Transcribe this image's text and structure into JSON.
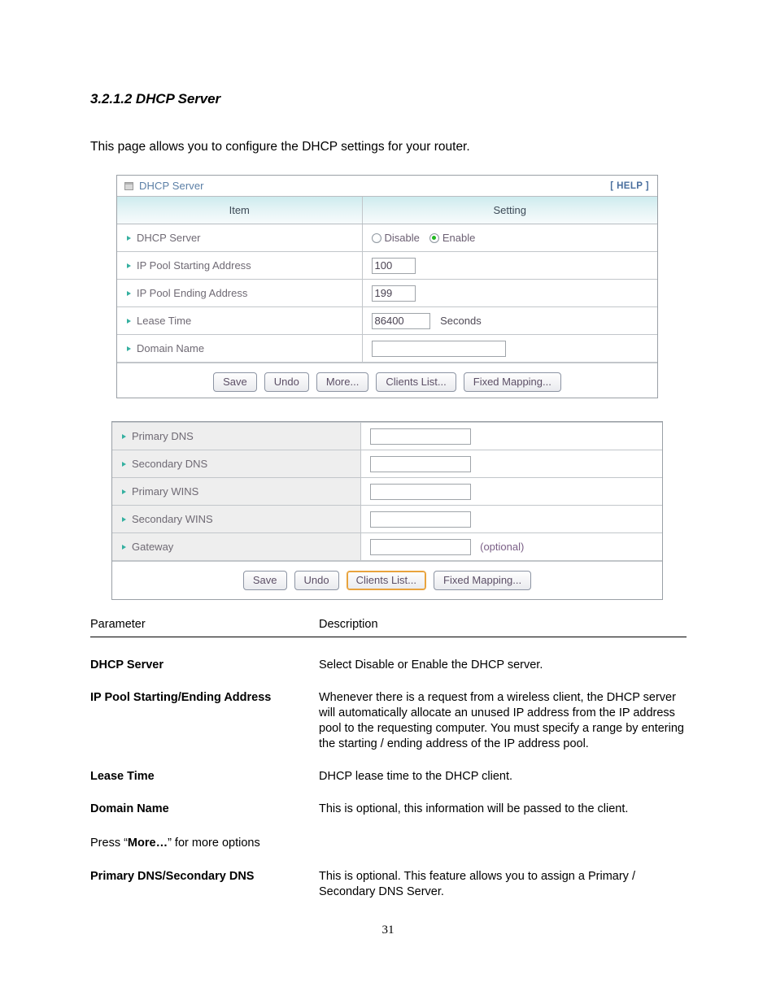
{
  "document": {
    "heading": "3.2.1.2 DHCP Server",
    "intro": "This page allows you to configure the DHCP settings for your router.",
    "page_number": "31"
  },
  "router_ui": {
    "panel_main": {
      "title": "DHCP Server",
      "title_icon": "window-icon",
      "help_label": "[ HELP ]",
      "columns": {
        "item": "Item",
        "setting": "Setting"
      },
      "rows": [
        {
          "label": "DHCP Server",
          "type": "radio",
          "options": [
            {
              "label": "Disable",
              "checked": false
            },
            {
              "label": "Enable",
              "checked": true
            }
          ]
        },
        {
          "label": "IP Pool Starting Address",
          "type": "text",
          "value": "100",
          "placeholder": ""
        },
        {
          "label": "IP Pool Ending Address",
          "type": "text",
          "value": "199",
          "placeholder": ""
        },
        {
          "label": "Lease Time",
          "type": "text",
          "value": "86400",
          "placeholder": "",
          "unit": "Seconds"
        },
        {
          "label": "Domain Name",
          "type": "text",
          "value": "",
          "placeholder": ""
        }
      ],
      "buttons": [
        {
          "label": "Save",
          "focused": false
        },
        {
          "label": "Undo",
          "focused": false
        },
        {
          "label": "More...",
          "focused": false
        },
        {
          "label": "Clients List...",
          "focused": false
        },
        {
          "label": "Fixed Mapping...",
          "focused": false
        }
      ]
    },
    "panel_more": {
      "rows": [
        {
          "label": "Primary DNS",
          "type": "text",
          "value": "",
          "placeholder": ""
        },
        {
          "label": "Secondary DNS",
          "type": "text",
          "value": "",
          "placeholder": ""
        },
        {
          "label": "Primary WINS",
          "type": "text",
          "value": "",
          "placeholder": ""
        },
        {
          "label": "Secondary WINS",
          "type": "text",
          "value": "",
          "placeholder": ""
        },
        {
          "label": "Gateway",
          "type": "text",
          "value": "",
          "placeholder": "",
          "suffix": "(optional)"
        }
      ],
      "buttons": [
        {
          "label": "Save",
          "focused": false
        },
        {
          "label": "Undo",
          "focused": false
        },
        {
          "label": "Clients List...",
          "focused": true
        },
        {
          "label": "Fixed Mapping...",
          "focused": false
        }
      ]
    }
  },
  "description_table": {
    "headers": {
      "parameter": "Parameter",
      "description": "Description"
    },
    "rows": [
      {
        "parameter": "DHCP Server",
        "description": "Select Disable or Enable the DHCP server."
      },
      {
        "parameter": "IP Pool Starting/Ending Address",
        "description": "Whenever there is a request from a wireless client, the DHCP server will automatically allocate an unused IP address from the IP address pool to the requesting computer. You must specify a range by entering the starting / ending address of the IP address pool."
      },
      {
        "parameter": "Lease Time",
        "description": "DHCP lease time to the DHCP client."
      },
      {
        "parameter": "Domain Name",
        "description": "This is optional, this information will be passed to the client."
      }
    ],
    "note_prefix": "Press “",
    "note_bold": "More…",
    "note_suffix": "” for more options",
    "final_row": {
      "parameter": "Primary DNS/Secondary DNS",
      "description": "This is optional. This feature allows you to assign a Primary / Secondary DNS Server."
    }
  },
  "colors": {
    "panel_border": "#9aa0a6",
    "header_gradient_top": "#cdebee",
    "title_text": "#5b7fa6",
    "bullet": "#35b0a0",
    "label_text": "#6f6a74",
    "radio_checked": "#1fb81f",
    "focus_ring": "#e8a33d",
    "grey_label_bg": "#eeeeee"
  }
}
